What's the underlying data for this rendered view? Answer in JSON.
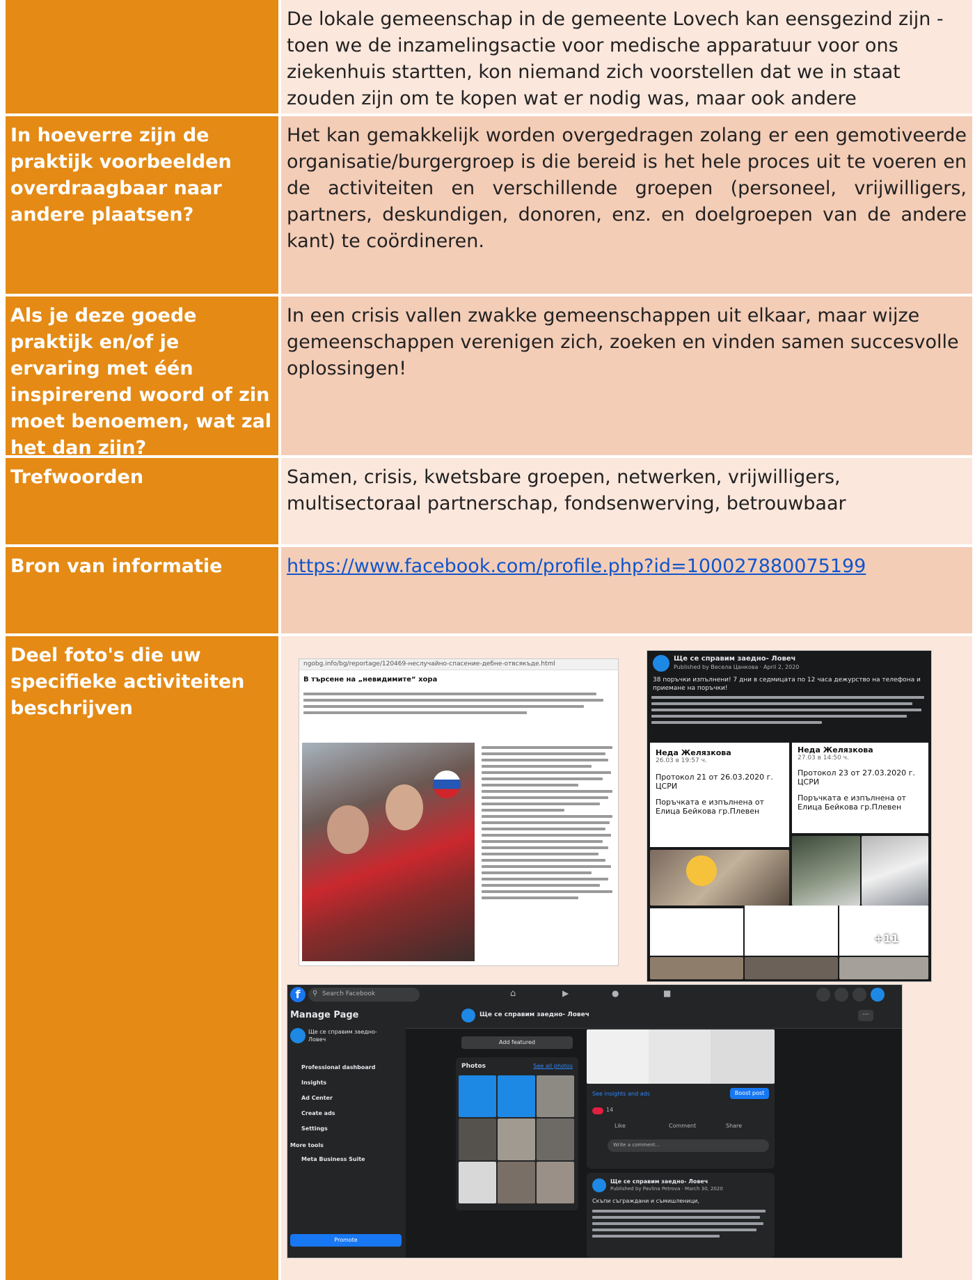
{
  "rows": [
    {
      "label": "",
      "value": "De lokale gemeenschap in de gemeente Lovech kan eensgezind zijn - toen we de inzamelingsactie voor medische apparatuur voor ons ziekenhuis startten, kon niemand zich voorstellen dat we in staat zouden zijn om te kopen wat er nodig was, maar ook andere apparatuur en verbruiksartikelen."
    },
    {
      "label": "In hoeverre zijn de praktijk voorbeelden overdraagbaar naar andere plaatsen?",
      "value": "Het kan gemakkelijk worden overgedragen zolang er een gemotiveerde organisatie/burgergroep is die bereid is het hele proces uit te voeren en de activiteiten en verschillende groepen (personeel, vrijwilligers, partners, deskundigen, donoren, enz. en doelgroepen van de andere kant) te coördineren."
    },
    {
      "label": "Als je deze goede praktijk en/of je ervaring met één inspirerend woord of zin moet benoemen, wat zal het dan zijn?",
      "value": "In een crisis vallen zwakke gemeenschappen uit elkaar, maar wijze gemeenschappen verenigen zich, zoeken en vinden samen succesvolle oplossingen!"
    },
    {
      "label": "Trefwoorden",
      "value": "Samen, crisis, kwetsbare groepen, netwerken, vrijwilligers, multisectoraal partnerschap, fondsenwerving, betrouwbaar"
    },
    {
      "label": "Bron van informatie",
      "value": " https://www.facebook.com/profile.php?id=100027880075199"
    },
    {
      "label": "Deel foto's die uw specifieke activiteiten beschrijven",
      "value": ""
    }
  ],
  "photos": {
    "article": {
      "url": "ngobg.info/bg/reportage/120469-неслучайно-спасение-дебне-отвсякъде.html",
      "title": "В търсене на „невидимите“ хора"
    },
    "posts": {
      "page": "Ще се справим заедно- Ловеч",
      "published_by": "Published by Весела Цанкова · April 2, 2020",
      "text": "38 поръчки изпълнени! 7 дни в седмицата по 12 часа дежурство на телефона и приемане на поръчки!",
      "card1_name": "Неда Желязкова",
      "card1_time": "26.03 в 19:57 ч.",
      "card1_text": "Протокол 21 от 26.03.2020 г. ЦСРИ",
      "card1_text2": "Поръчката е изпълнена от Елица Бейкова гр.Плевен",
      "card2_name": "Неда Желязкова",
      "card2_time": "27.03 в 14:50 ч.",
      "card2_text": "Протокол 23 от 27.03.2020 г. ЦСРИ",
      "card2_text2": "Поръчката е изпълнена от Елица Бейкова гр.Плевен",
      "more_count": "+11"
    },
    "fb_page": {
      "search_placeholder": "Search Facebook",
      "manage_title": "Manage Page",
      "page_name": "Ще се справим заедно- Ловеч",
      "nav": [
        "Professional dashboard",
        "Insights",
        "Ad Center",
        "Create ads",
        "Settings"
      ],
      "more_tools": "More tools",
      "business_suite": "Meta Business Suite",
      "promote": "Promote",
      "add_featured": "Add featured",
      "photos_label": "Photos",
      "see_all_photos": "See all photos",
      "see_insights": "See insights and ads",
      "boost_post": "Boost post",
      "reactions": "14",
      "like": "Like",
      "comment": "Comment",
      "share": "Share",
      "write_comment": "Write a comment...",
      "post2_by": "Published by Pavlina Petrova · March 30, 2020",
      "post2_greeting": "Скъпи съграждани и съмишленици,"
    }
  }
}
